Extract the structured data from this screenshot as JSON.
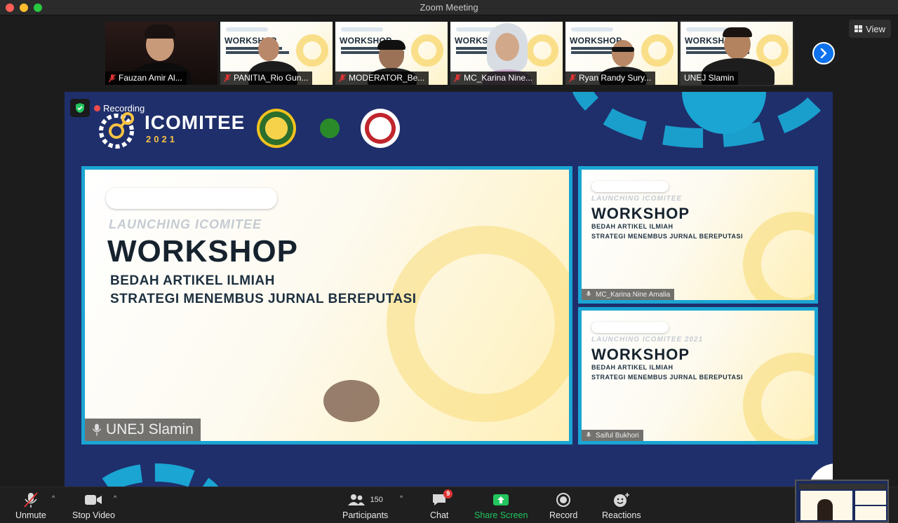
{
  "window": {
    "title": "Zoom Meeting"
  },
  "thumbnails": [
    {
      "name": "Fauzan Amir Al...",
      "muted": true
    },
    {
      "name": "PANITIA_Rio Gun...",
      "muted": true
    },
    {
      "name": "MODERATOR_Be...",
      "muted": true
    },
    {
      "name": "MC_Karina Nine...",
      "muted": true
    },
    {
      "name": "Ryan Randy Sury...",
      "muted": true
    },
    {
      "name": "UNEJ Slamin",
      "muted": false
    }
  ],
  "view_button": {
    "label": "View"
  },
  "recording": {
    "label": "Recording"
  },
  "share": {
    "event_name": "ICOMITEE",
    "event_year": "2021",
    "main_panel": {
      "launch_text": "LAUNCHING ICOMITEE",
      "title": "WORKSHOP",
      "sub1": "BEDAH ARTIKEL ILMIAH",
      "sub2": "STRATEGI MENEMBUS JURNAL BEREPUTASI",
      "speaker": "UNEJ Slamin"
    },
    "side_panel_1": {
      "launch_text": "LAUNCHING ICOMITEE",
      "title": "WORKSHOP",
      "sub1": "BEDAH ARTIKEL ILMIAH",
      "sub2": "STRATEGI MENEMBUS JURNAL BEREPUTASI",
      "speaker": "MC_Karina Nine Amalia"
    },
    "side_panel_2": {
      "launch_text": "LAUNCHING ICOMITEE 2021",
      "title": "WORKSHOP",
      "sub1": "BEDAH ARTIKEL ILMIAH",
      "sub2": "STRATEGI MENEMBUS JURNAL BEREPUTASI",
      "speaker": "Saiful Bukhori"
    }
  },
  "toolbar": {
    "unmute": "Unmute",
    "stop_video": "Stop Video",
    "participants": "Participants",
    "participants_count": "150",
    "chat": "Chat",
    "chat_badge": "9",
    "share_screen": "Share Screen",
    "record": "Record",
    "reactions": "Reactions"
  },
  "colors": {
    "accent_blue": "#0e72ed",
    "share_green": "#22c55e",
    "muted_red": "#e03434",
    "slide_frame": "#1aa5d3",
    "background_navy": "#1f2f6b",
    "brand_yellow": "#f6c343"
  }
}
